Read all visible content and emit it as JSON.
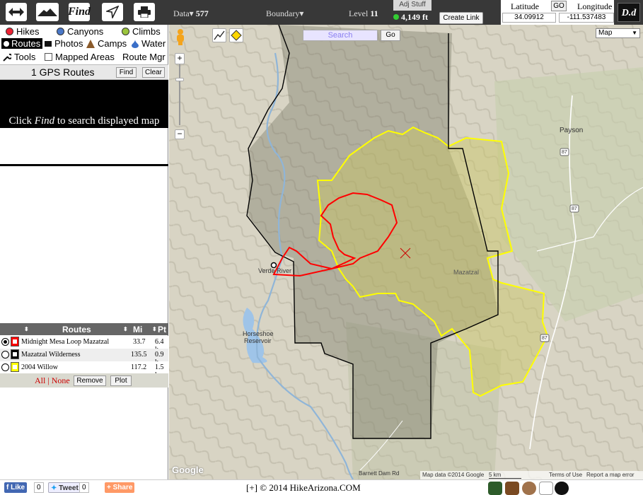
{
  "topbar": {
    "find_label": "Find",
    "data_label": "Data",
    "data_count": "577",
    "boundary_label": "Boundary",
    "level_label": "Level",
    "level_value": "11",
    "adj_stuff": "Adj Stuff",
    "elevation": "4,149 ft",
    "create_link": "Create Link",
    "latitude_label": "Latitude",
    "longitude_label": "Longitude",
    "go_label": "GO",
    "latitude": "34.09912",
    "longitude": "-111.537483",
    "format_button": "D.d"
  },
  "left": {
    "categories": {
      "hikes": "Hikes",
      "canyons": "Canyons",
      "climbs": "Climbs",
      "routes": "Routes",
      "photos": "Photos",
      "camps": "Camps",
      "water": "Water",
      "tools": "Tools",
      "mapped_areas": "Mapped Areas",
      "route_mgr": "Route Mgr"
    },
    "gps_title": "1 GPS Routes",
    "find_btn": "Find",
    "clear_btn": "Clear",
    "click_find_prefix": "Click ",
    "click_find_word": "Find",
    "click_find_suffix": " to search displayed map",
    "table": {
      "headers": [
        "Routes",
        "Mi",
        "Pt"
      ],
      "rows": [
        {
          "name": "Midnight Mesa Loop Mazatzal",
          "mi": "33.7",
          "pt": "6.4 k",
          "color": "#ff0000"
        },
        {
          "name": "Mazatzal Wilderness",
          "mi": "135.5",
          "pt": "0.9 k",
          "color": "#000000"
        },
        {
          "name": "2004 Willow",
          "mi": "117.2",
          "pt": "1.5 k",
          "color": "#ffff00"
        }
      ],
      "all": "All",
      "none": "None",
      "remove": "Remove",
      "plot": "Plot"
    }
  },
  "map": {
    "search_placeholder": "Search",
    "go": "Go",
    "map_type": "Map",
    "labels": {
      "payson": "Payson",
      "verde_river": "Verde River",
      "horseshoe": "Horseshoe",
      "reservoir": "Reservoir",
      "mazatzal": "Mazatzal",
      "barnett": "Barnett Dam Rd"
    },
    "road_87": "87",
    "google": "Google",
    "map_data": "Map data ©2014 Google",
    "scale": "5 km",
    "terms": "Terms of Use",
    "report": "Report a map error"
  },
  "footer": {
    "like": "Like",
    "like_count": "0",
    "tweet": "Tweet",
    "tweet_count": "0",
    "share": "Share",
    "expander": "[+]",
    "copyright": "© 2014 HikeArizona.COM"
  },
  "colors": {
    "route_red": "#ff0000",
    "boundary_black": "#000000",
    "willow_yellow": "#ffff00"
  }
}
